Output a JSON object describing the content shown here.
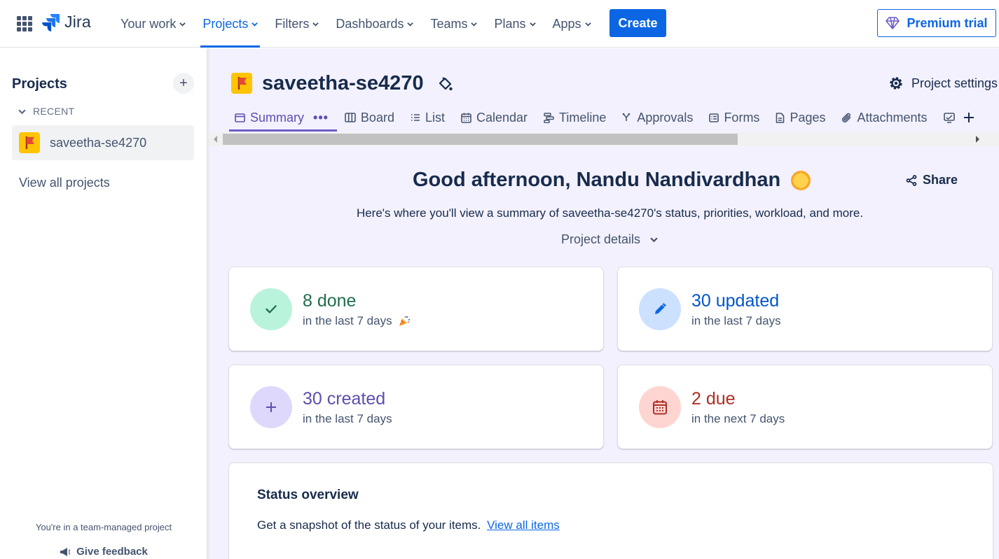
{
  "topnav": {
    "logo_text": "Jira",
    "items": [
      {
        "label": "Your work"
      },
      {
        "label": "Projects"
      },
      {
        "label": "Filters"
      },
      {
        "label": "Dashboards"
      },
      {
        "label": "Teams"
      },
      {
        "label": "Plans"
      },
      {
        "label": "Apps"
      }
    ],
    "active_item": "Projects",
    "create_label": "Create",
    "premium_label": "Premium trial"
  },
  "sidebar": {
    "title": "Projects",
    "recent_label": "RECENT",
    "recent_items": [
      {
        "label": "saveetha-se4270"
      }
    ],
    "view_all_label": "View all projects",
    "team_managed_text": "You're in a team-managed project",
    "feedback_label": "Give feedback"
  },
  "project": {
    "name": "saveetha-se4270",
    "settings_label": "Project settings",
    "tabs": [
      {
        "label": "Summary",
        "icon": "summary-icon"
      },
      {
        "label": "Board",
        "icon": "board-icon"
      },
      {
        "label": "List",
        "icon": "list-icon"
      },
      {
        "label": "Calendar",
        "icon": "calendar-icon"
      },
      {
        "label": "Timeline",
        "icon": "timeline-icon"
      },
      {
        "label": "Approvals",
        "icon": "approvals-icon"
      },
      {
        "label": "Forms",
        "icon": "forms-icon"
      },
      {
        "label": "Pages",
        "icon": "pages-icon"
      },
      {
        "label": "Attachments",
        "icon": "attachments-icon"
      }
    ],
    "active_tab": "Summary",
    "tab_more": "•••"
  },
  "summary": {
    "greeting": "Good afternoon, Nandu Nandivardhan",
    "share_label": "Share",
    "subtitle": "Here's where you'll view a summary of saveetha-se4270's status, priorities, workload, and more.",
    "project_details_label": "Project details",
    "cards": [
      {
        "value": "8 done",
        "sub": "in the last 7 days",
        "color": "#216e4e",
        "circle": "#baf3db",
        "icon": "check-icon"
      },
      {
        "value": "30 updated",
        "sub": "in the last 7 days",
        "color": "#0055cc",
        "circle": "#cce0ff",
        "icon": "pencil-icon"
      },
      {
        "value": "30 created",
        "sub": "in the last 7 days",
        "color": "#5e4db2",
        "circle": "#dfd8fd",
        "icon": "plus-icon"
      },
      {
        "value": "2 due",
        "sub": "in the next 7 days",
        "color": "#ae2e24",
        "circle": "#ffd5d2",
        "icon": "calendar-icon"
      }
    ],
    "status_overview": {
      "title": "Status overview",
      "description": "Get a snapshot of the status of your items.",
      "link_label": "View all items"
    }
  }
}
